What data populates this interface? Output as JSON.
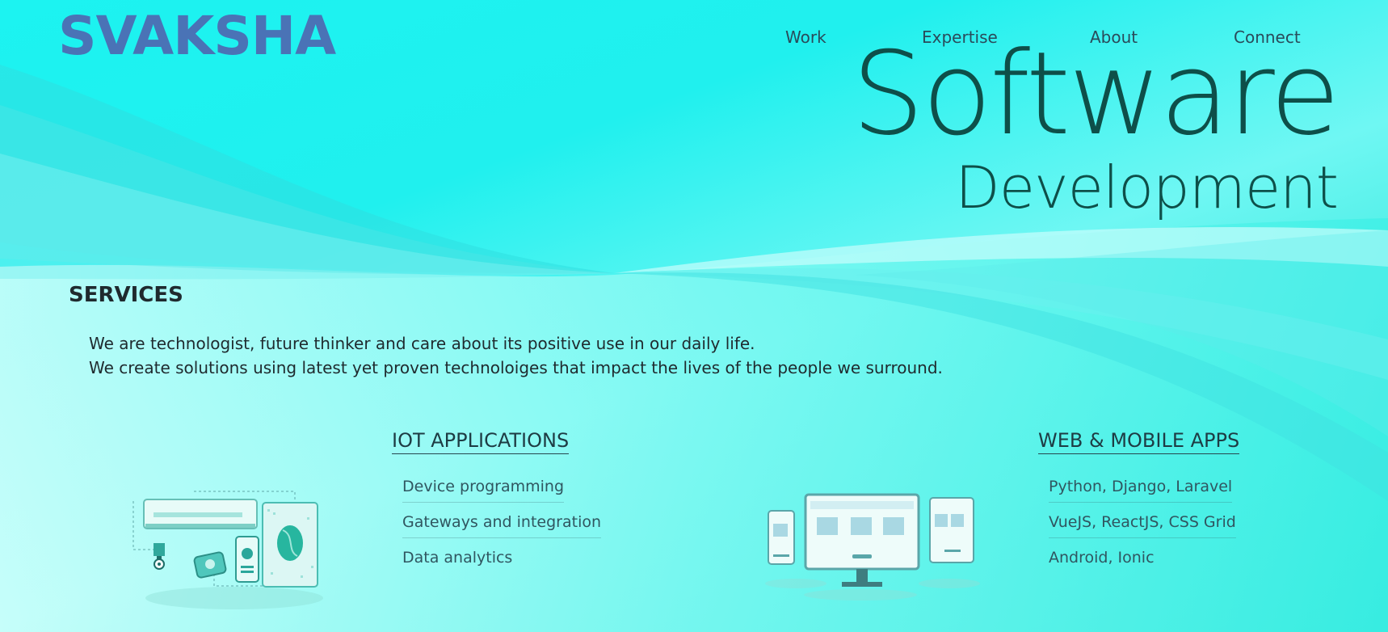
{
  "brand": {
    "logo_text": "SVAKSHA"
  },
  "nav": {
    "items": [
      "Work",
      "Expertise",
      "About",
      "Connect"
    ]
  },
  "hero": {
    "title": "Software",
    "subtitle": "Development"
  },
  "services": {
    "title": "SERVICES",
    "description": [
      "We are technologist, future thinker and care about its positive use in our daily life.",
      "We create solutions using latest yet proven technoloiges that impact the lives of the people we surround."
    ],
    "iot": {
      "heading": "IOT APPLICATIONS",
      "items": [
        "Device programming",
        "Gateways and integration",
        "Data analytics"
      ]
    },
    "web": {
      "heading": "WEB & MOBILE APPS",
      "items": [
        "Python, Django, Laravel",
        "VueJS, ReactJS, CSS Grid",
        "Android, Ionic"
      ]
    }
  },
  "colors": {
    "logo": "#4a73b6",
    "hero_text": "#0e4f49",
    "background_top": "#1cf3f1",
    "background_bottom": "#0bd6c3"
  }
}
